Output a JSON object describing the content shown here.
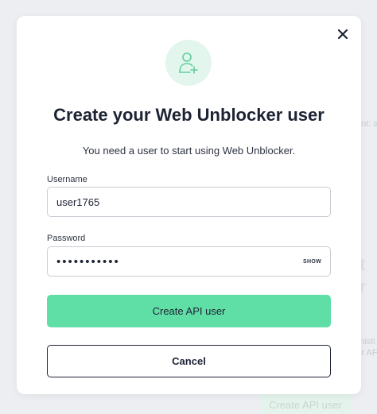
{
  "background": {
    "fragments": [
      "ent: a",
      "t",
      "r",
      "nisti",
      "ir AF"
    ],
    "button_label": "Create API user"
  },
  "modal": {
    "icon": "user-add-icon",
    "title": "Create your Web Unblocker user",
    "subtitle": "You need a user to start using Web Unblocker.",
    "username": {
      "label": "Username",
      "value": "user1765"
    },
    "password": {
      "label": "Password",
      "value": "•••••••••••",
      "show_label": "SHOW"
    },
    "primary_button": "Create API user",
    "secondary_button": "Cancel",
    "close_icon": "close-icon"
  },
  "colors": {
    "accent": "#5fdea6",
    "icon_bg": "#e3f6ee",
    "text_dark": "#1d2333",
    "backdrop": "#eceef1"
  }
}
